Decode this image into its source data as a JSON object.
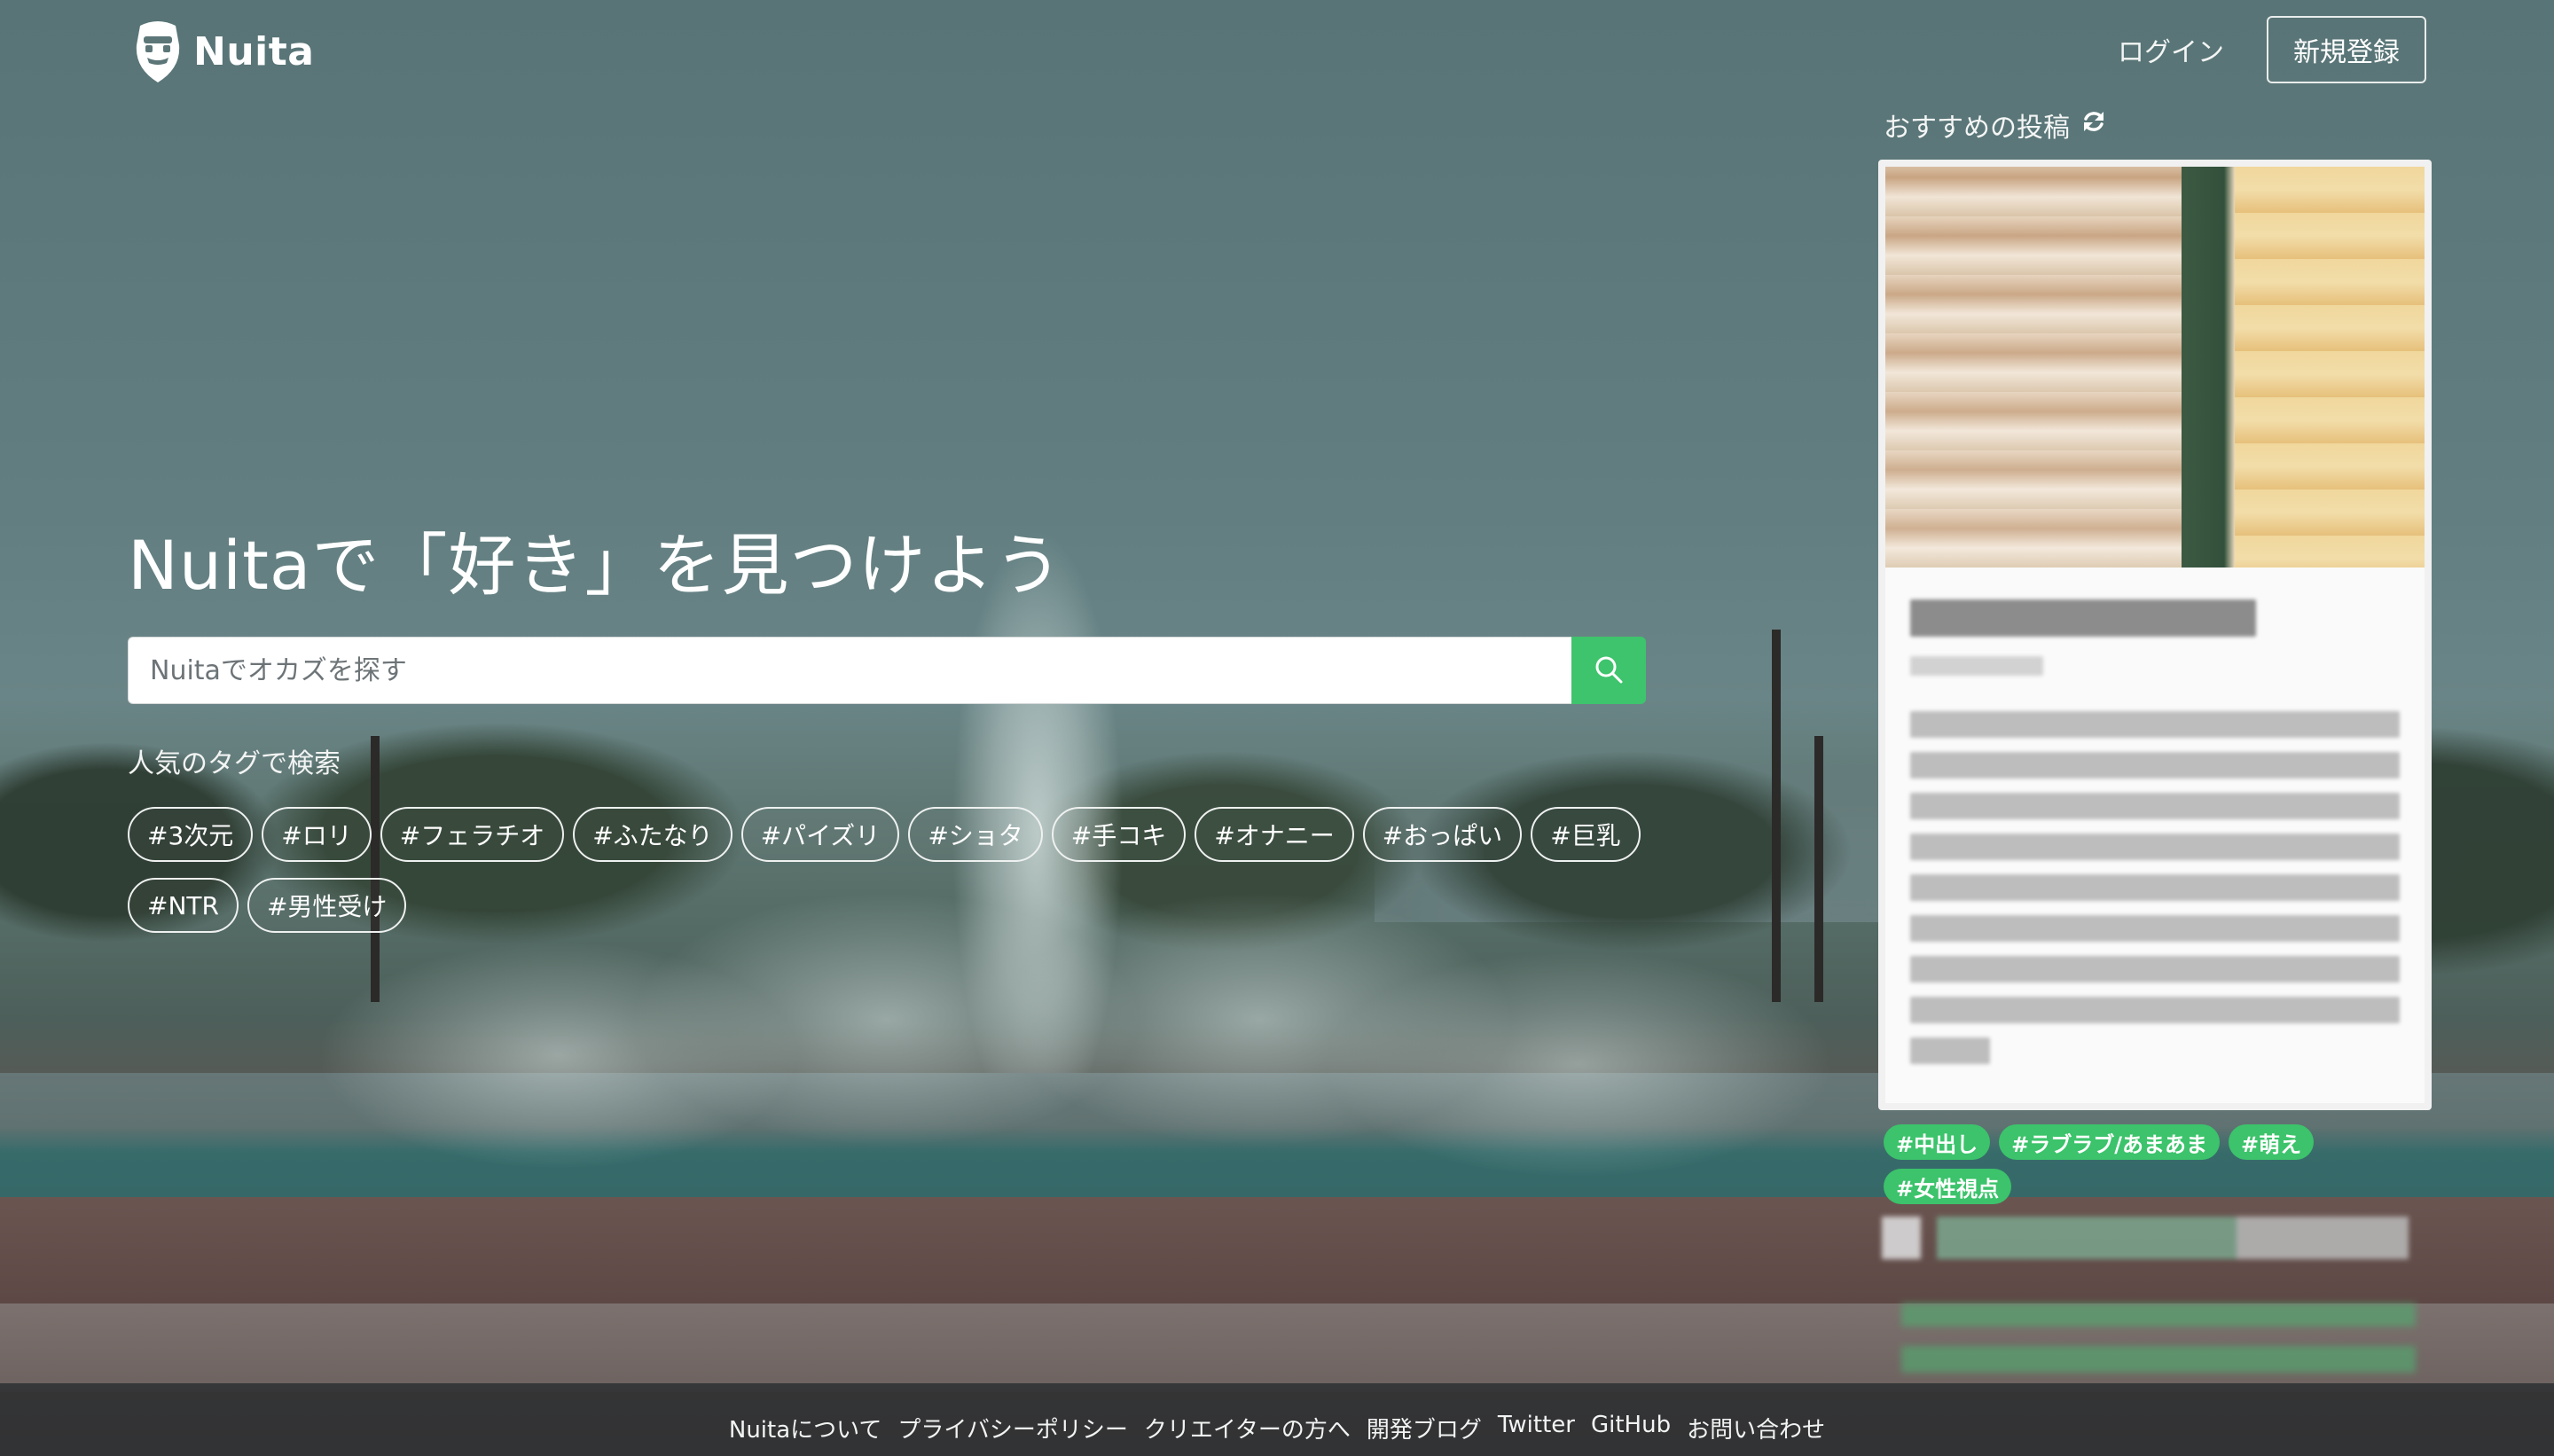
{
  "header": {
    "logo_text": "Nuita",
    "login_label": "ログイン",
    "signup_label": "新規登録"
  },
  "hero": {
    "title": "Nuitaで「好き」を見つけよう",
    "search_placeholder": "Nuitaでオカズを探す",
    "tags_heading": "人気のタグで検索",
    "tags": [
      "#3次元",
      "#ロリ",
      "#フェラチオ",
      "#ふたなり",
      "#パイズリ",
      "#ショタ",
      "#手コキ",
      "#オナニー",
      "#おっぱい",
      "#巨乳",
      "#NTR",
      "#男性受け"
    ]
  },
  "recommended": {
    "heading": "おすすめの投稿",
    "tags": [
      "#中出し",
      "#ラブラブ/あまあま",
      "#萌え",
      "#女性視点"
    ]
  },
  "footer": {
    "links": [
      "Nuitaについて",
      "プライバシーポリシー",
      "クリエイターの方へ",
      "開発ブログ",
      "Twitter",
      "GitHub",
      "お問い合わせ"
    ]
  },
  "colors": {
    "accent": "#3ec46d",
    "tag_green": "#3cc36b"
  },
  "icons": {
    "logo": "bearded-face-icon",
    "search": "search-icon",
    "refresh": "refresh-icon"
  }
}
